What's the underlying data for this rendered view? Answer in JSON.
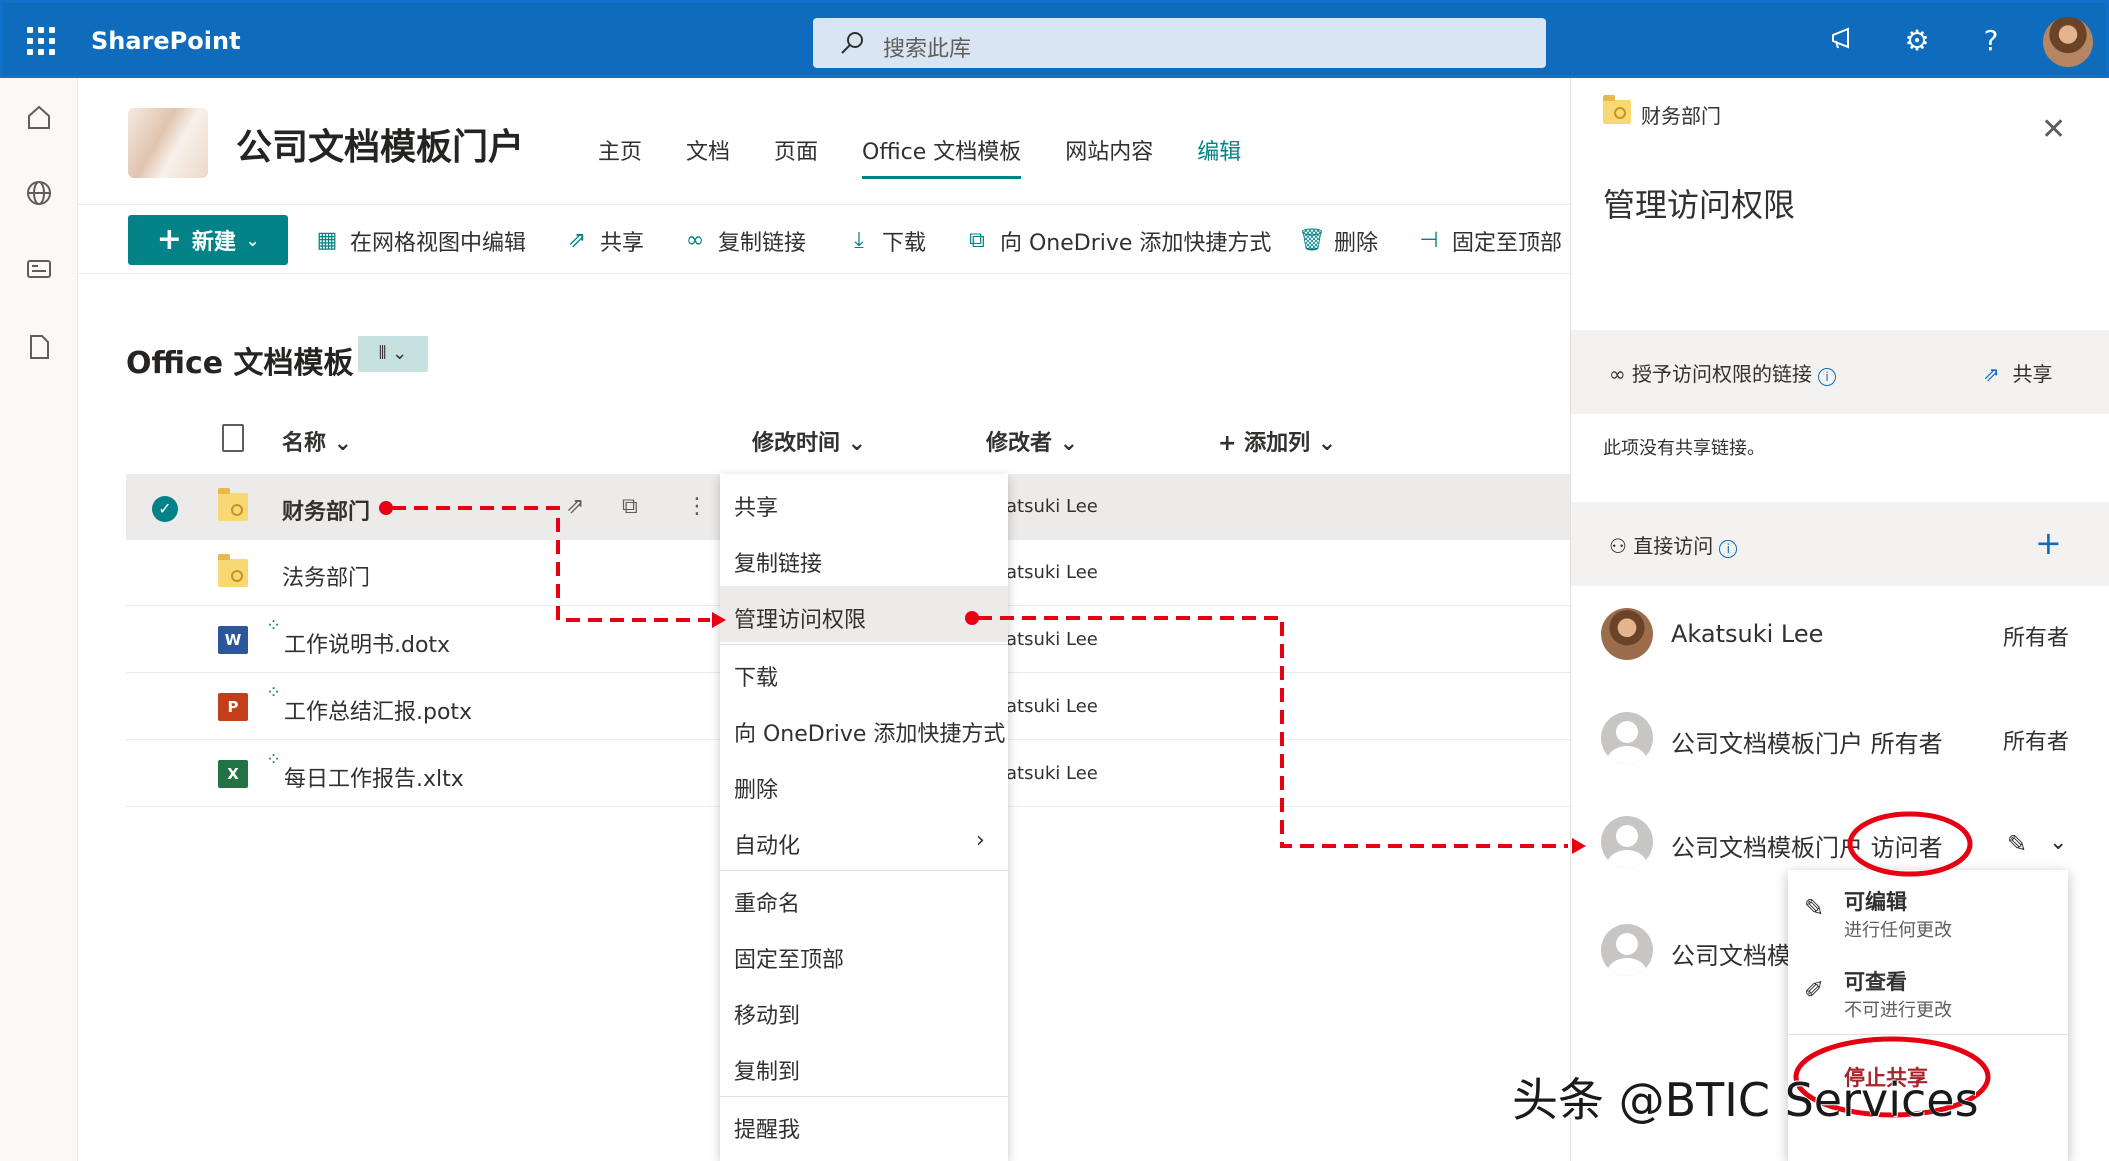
{
  "suite": {
    "brand": "SharePoint",
    "search_placeholder": "搜索此库"
  },
  "site": {
    "title": "公司文档模板门户",
    "nav": [
      "主页",
      "文档",
      "页面",
      "Office 文档模板",
      "网站内容",
      "编辑"
    ]
  },
  "cmdbar": {
    "new": "新建",
    "grid_edit": "在网格视图中编辑",
    "share": "共享",
    "copy_link": "复制链接",
    "download": "下载",
    "add_shortcut": "向 OneDrive 添加快捷方式",
    "delete": "删除",
    "pin": "固定至顶部"
  },
  "library": {
    "title": "Office 文档模板",
    "columns": {
      "name": "名称",
      "modified": "修改时间",
      "modified_by": "修改者",
      "add_column": "添加列"
    },
    "rows": [
      {
        "name": "财务部门",
        "type": "folder",
        "modified_by": "Akatsuki Lee",
        "modified_by_visible": "atsuki Lee"
      },
      {
        "name": "法务部门",
        "type": "folder",
        "modified_by": "Akatsuki Lee",
        "modified_by_visible": "atsuki Lee"
      },
      {
        "name": "工作说明书.dotx",
        "type": "word",
        "modified_by": "Akatsuki Lee",
        "modified_by_visible": "atsuki Lee"
      },
      {
        "name": "工作总结汇报.potx",
        "type": "ppt",
        "modified_by": "Akatsuki Lee",
        "modified_by_visible": "atsuki Lee"
      },
      {
        "name": "每日工作报告.xltx",
        "type": "excel",
        "modified_by": "Akatsuki Lee",
        "modified_by_visible": "atsuki Lee"
      }
    ]
  },
  "context_menu": {
    "items": [
      "共享",
      "复制链接",
      "管理访问权限",
      "下载",
      "向 OneDrive 添加快捷方式",
      "删除",
      "自动化",
      "重命名",
      "固定至顶部",
      "移动到",
      "复制到",
      "提醒我"
    ]
  },
  "panel": {
    "breadcrumb": "财务部门",
    "title": "管理访问权限",
    "links_section": "授予访问权限的链接",
    "share": "共享",
    "no_links": "此项没有共享链接。",
    "direct_access": "直接访问",
    "people": [
      {
        "name": "Akatsuki Lee",
        "role": "所有者"
      },
      {
        "name": "公司文档模板门户 所有者",
        "role": "所有者"
      },
      {
        "name": "公司文档模板门户 访问者",
        "role": ""
      },
      {
        "name": "公司文档模",
        "role": ""
      }
    ],
    "perm_options": [
      {
        "title": "可编辑",
        "subtitle": "进行任何更改"
      },
      {
        "title": "可查看",
        "subtitle": "不可进行更改"
      }
    ],
    "stop_sharing": "停止共享"
  },
  "watermark": "头条 @BTIC Services",
  "colors": {
    "suite_blue": "#0f6cbd",
    "teal": "#038387",
    "annotation_red": "#e60012"
  }
}
